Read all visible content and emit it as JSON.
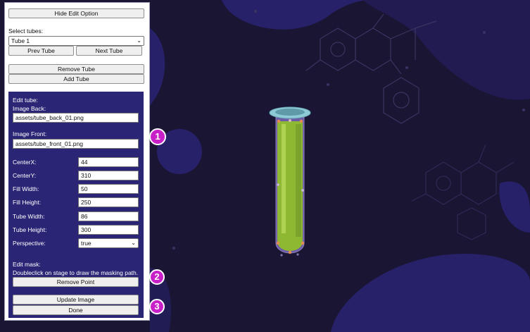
{
  "panel": {
    "hide_edit_label": "Hide Edit Option",
    "select_tubes_label": "Select tubes:",
    "tube_select_value": "Tube 1",
    "prev_label": "Prev Tube",
    "next_label": "Next Tube",
    "remove_tube_label": "Remove Tube",
    "add_tube_label": "Add Tube"
  },
  "edit": {
    "title": "Edit tube:",
    "image_back_label": "Image Back:",
    "image_back_value": "assets/tube_back_01.png",
    "image_front_label": "Image Front:",
    "image_front_value": "assets/tube_front_01.png",
    "fields": [
      {
        "label": "CenterX:",
        "value": "44"
      },
      {
        "label": "CenterY:",
        "value": "310"
      },
      {
        "label": "Fill Width:",
        "value": "50"
      },
      {
        "label": "Fill Height:",
        "value": "250"
      },
      {
        "label": "Tube Width:",
        "value": "86"
      },
      {
        "label": "Tube Height:",
        "value": "300"
      }
    ],
    "perspective_label": "Perspective:",
    "perspective_value": "true"
  },
  "mask": {
    "title": "Edit mask:",
    "hint": "Doubleclick on stage to draw the masking path.",
    "remove_point_label": "Remove Point"
  },
  "actions": {
    "update_label": "Update Image",
    "done_label": "Done"
  },
  "badges": [
    "1",
    "2",
    "3"
  ],
  "colors": {
    "stage_bg": "#1a1533",
    "panel_inner": "#2a2575",
    "badge": "#c91fc9",
    "liquid": "#8fb832",
    "tube_rim": "#8ccbd6"
  }
}
